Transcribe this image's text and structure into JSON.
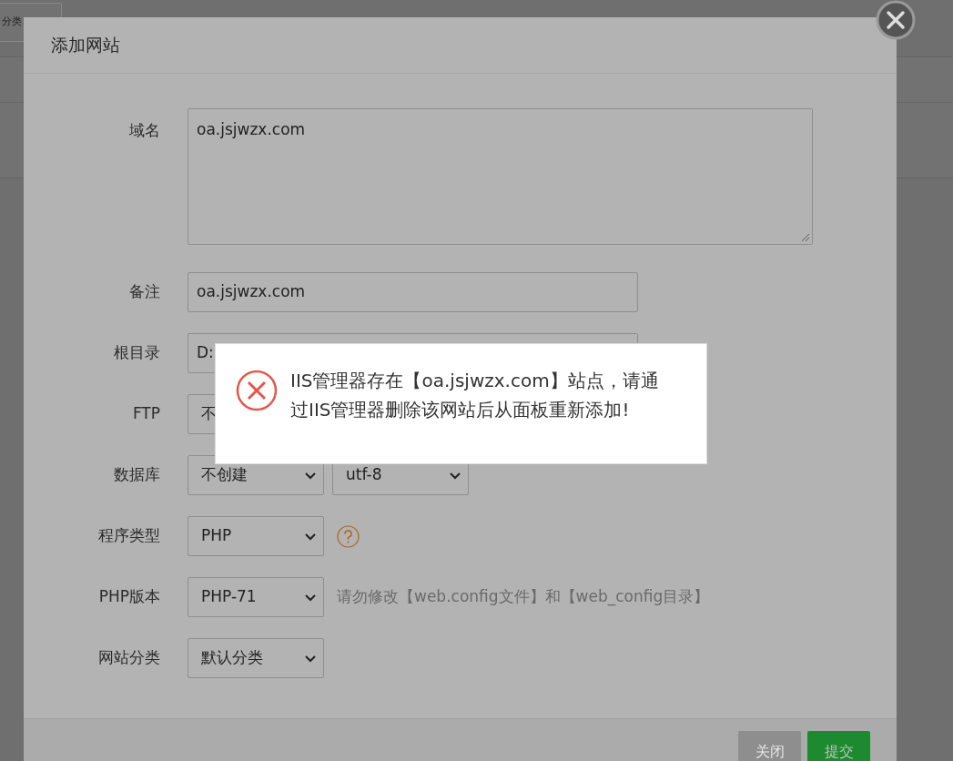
{
  "background": {
    "button": "分类"
  },
  "dialog": {
    "title": "添加网站",
    "fields": [
      {
        "kind": "textarea",
        "label": "域名",
        "value": "oa.jsjwzx.com"
      },
      {
        "kind": "input",
        "label": "备注",
        "value": "oa.jsjwzx.com"
      },
      {
        "kind": "input",
        "label": "根目录",
        "value": "D:"
      },
      {
        "kind": "covered-select",
        "label": "FTP",
        "value": "不"
      },
      {
        "kind": "selects",
        "label": "数据库",
        "values": [
          "不创建",
          "utf-8"
        ]
      },
      {
        "kind": "select",
        "label": "程序类型",
        "value": "PHP",
        "help": true
      },
      {
        "kind": "select",
        "label": "PHP版本",
        "value": "PHP-71",
        "hint": "请勿修改【web.config文件】和【web_config目录】"
      },
      {
        "kind": "select",
        "label": "网站分类",
        "value": "默认分类"
      }
    ],
    "buttons": [
      {
        "label": "关闭",
        "kind": "secondary"
      },
      {
        "label": "提交",
        "kind": "primary"
      }
    ]
  },
  "alert": {
    "kind": "error",
    "message": "IIS管理器存在【oa.jsjwzx.com】站点，请通过IIS管理器删除该网站后从面板重新添加!"
  }
}
